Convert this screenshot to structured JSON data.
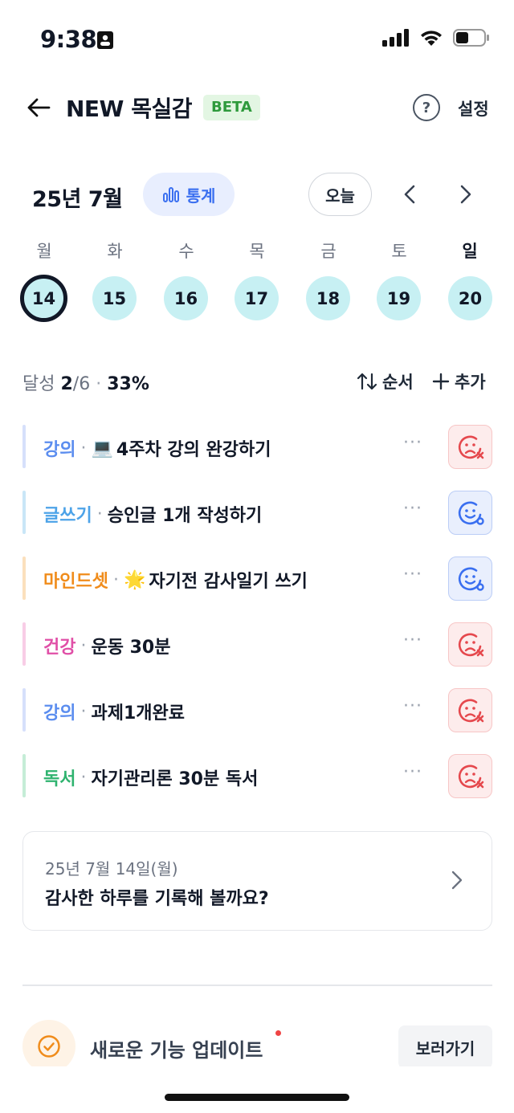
{
  "status_bar": {
    "time": "9:38"
  },
  "header": {
    "title": "NEW 목실감",
    "badge": "BETA",
    "help_label": "?",
    "settings_label": "설정"
  },
  "calendar": {
    "month": "25년 7월",
    "stats_label": "통계",
    "today_label": "오늘",
    "weekdays": [
      "월",
      "화",
      "수",
      "목",
      "금",
      "토",
      "일"
    ],
    "days": [
      "14",
      "15",
      "16",
      "17",
      "18",
      "19",
      "20"
    ],
    "selected_index": 0
  },
  "summary": {
    "label": "달성",
    "done": "2",
    "total": "/6",
    "sep": "·",
    "percent": "33%",
    "order_label": "순서",
    "add_label": "추가"
  },
  "tasks": [
    {
      "category": "강의",
      "title": "4주차 강의 완강하기",
      "emoji": "💻",
      "color": "#5B8DEF",
      "bar": "#D6E0FB",
      "status": "fail"
    },
    {
      "category": "글쓰기",
      "title": "승인글 1개 작성하기",
      "emoji": "",
      "color": "#4DA3E8",
      "bar": "#C9E6F7",
      "status": "done"
    },
    {
      "category": "마인드셋",
      "title": "자기전 감사일기 쓰기",
      "emoji": "🌟",
      "color": "#F08C1B",
      "bar": "#FBE0BD",
      "status": "done"
    },
    {
      "category": "건강",
      "title": "운동 30분",
      "emoji": "",
      "color": "#E04FA7",
      "bar": "#F8CDE6",
      "status": "fail"
    },
    {
      "category": "강의",
      "title": "과제1개완료",
      "emoji": "",
      "color": "#5B8DEF",
      "bar": "#D6E0FB",
      "status": "fail"
    },
    {
      "category": "독서",
      "title": "자기관리론 30분 독서",
      "emoji": "",
      "color": "#2FB36F",
      "bar": "#C5EDD7",
      "status": "fail"
    }
  ],
  "task_more": "···",
  "record": {
    "date": "25년 7월 14일(월)",
    "prompt": "감사한 하루를 기록해 볼까요?"
  },
  "update": {
    "text": "새로운 기능 업데이트",
    "button": "보러가기"
  },
  "colors": {
    "accent": "#3A6FF0",
    "day_bg": "#C7F0F3",
    "fail": "#E5484D",
    "done": "#3A6FF0"
  }
}
